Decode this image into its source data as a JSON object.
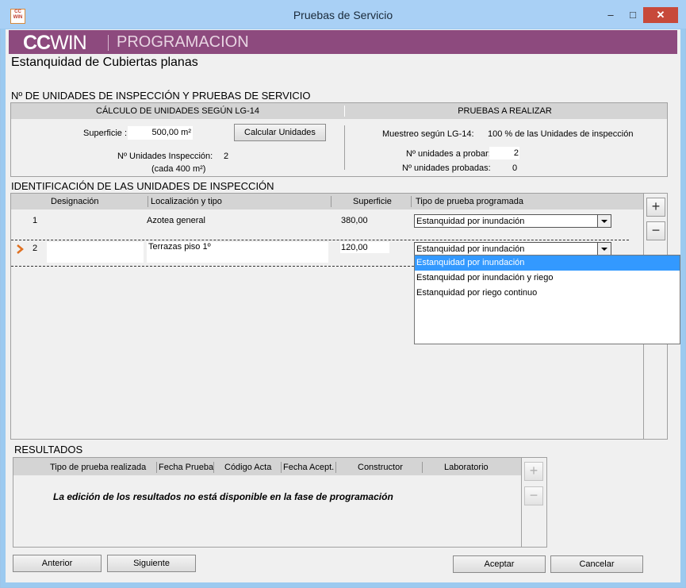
{
  "window": {
    "title": "Pruebas de Servicio",
    "icon_text": "CC WIN",
    "minimize_glyph": "–",
    "maximize_glyph": "□",
    "close_glyph": "✕"
  },
  "banner": {
    "logo_a": "CC",
    "logo_b": "WIN",
    "label": "PROGRAMACION",
    "color": "#8d4a7e"
  },
  "page_title": "Estanquidad de Cubiertas planas",
  "section1": {
    "label": "Nº DE UNIDADES DE INSPECCIÓN Y PRUEBAS DE SERVICIO",
    "left_head": "CÁLCULO DE UNIDADES SEGÚN LG-14",
    "right_head": "PRUEBAS A REALIZAR",
    "superficie_label": "Superficie :",
    "superficie_value": "500,00 m²",
    "calc_button": "Calcular Unidades",
    "n_unidades_label": "Nº Unidades Inspección:",
    "n_unidades_value": "2",
    "cada_label": "(cada 400 m²)",
    "muestreo_label": "Muestreo según LG-14:",
    "muestreo_value": "100 % de las Unidades de inspección",
    "probar_label": "Nº unidades a probar:",
    "probar_value": "2",
    "probadas_label": "Nº unidades probadas:",
    "probadas_value": "0"
  },
  "section2": {
    "label": "IDENTIFICACIÓN DE LAS UNIDADES DE INSPECCIÓN",
    "columns": [
      "Designación",
      "Localización y tipo",
      "Superficie",
      "Tipo de prueba programada"
    ],
    "rows": [
      {
        "num": "1",
        "designacion": "",
        "localizacion": "Azotea general",
        "superficie": "380,00",
        "tipo": "Estanquidad por inundación"
      },
      {
        "num": "2",
        "designacion": "",
        "localizacion": "Terrazas piso 1º",
        "superficie": "120,00",
        "tipo": "Estanquidad por inundación"
      }
    ],
    "dropdown_options": [
      "Estanquidad por inundación",
      "Estanquidad por inundación y riego",
      "Estanquidad por riego continuo"
    ],
    "selected_option": "Estanquidad por inundación",
    "add_glyph": "+",
    "remove_glyph": "−"
  },
  "section3": {
    "label": "RESULTADOS",
    "columns": [
      "Tipo de prueba realizada",
      "Fecha Prueba",
      "Código Acta",
      "Fecha Acept.",
      "Constructor",
      "Laboratorio"
    ],
    "message": "La edición de los resultados no está disponible en la fase de programación"
  },
  "footer": {
    "anterior": "Anterior",
    "siguiente": "Siguiente",
    "aceptar": "Aceptar",
    "cancelar": "Cancelar"
  },
  "colors": {
    "titlebar": "#a9d0f5",
    "close": "#c7493a",
    "selection": "#3399ff",
    "arrow": "#e07020"
  }
}
